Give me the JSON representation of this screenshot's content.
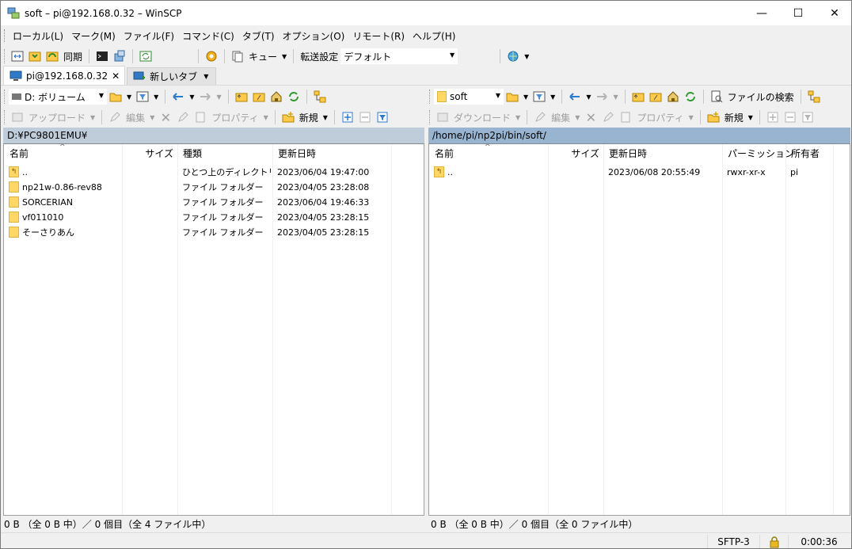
{
  "window": {
    "title": "soft – pi@192.168.0.32 – WinSCP"
  },
  "menu": [
    "ローカル(L)",
    "マーク(M)",
    "ファイル(F)",
    "コマンド(C)",
    "タブ(T)",
    "オプション(O)",
    "リモート(R)",
    "ヘルプ(H)"
  ],
  "toolbar": {
    "sync_label": "同期",
    "queue_label": "キュー",
    "transfer_settings_label": "転送設定",
    "transfer_preset": "デフォルト"
  },
  "tabs": [
    {
      "label": "pi@192.168.0.32",
      "active": true
    },
    {
      "label": "新しいタブ",
      "active": false
    }
  ],
  "local": {
    "drive": "D: ボリューム",
    "upload_label": "アップロード",
    "edit_label": "編集",
    "properties_label": "プロパティ",
    "new_label": "新規",
    "path": "D:¥PC9801EMU¥",
    "columns": [
      "名前",
      "サイズ",
      "種類",
      "更新日時"
    ],
    "files": [
      {
        "name": "..",
        "size": "",
        "type": "ひとつ上のディレクトリ",
        "modified": "2023/06/04 19:47:00",
        "up": true
      },
      {
        "name": "np21w-0.86-rev88",
        "size": "",
        "type": "ファイル フォルダー",
        "modified": "2023/04/05 23:28:08",
        "up": false
      },
      {
        "name": "SORCERIAN",
        "size": "",
        "type": "ファイル フォルダー",
        "modified": "2023/06/04 19:46:33",
        "up": false
      },
      {
        "name": "vf011010",
        "size": "",
        "type": "ファイル フォルダー",
        "modified": "2023/04/05 23:28:15",
        "up": false
      },
      {
        "name": "そーさりあん",
        "size": "",
        "type": "ファイル フォルダー",
        "modified": "2023/04/05 23:28:15",
        "up": false
      }
    ],
    "status": "0 B （全 0 B 中）／ 0 個目（全 4 ファイル中）"
  },
  "remote": {
    "folder": "soft",
    "download_label": "ダウンロード",
    "edit_label": "編集",
    "properties_label": "プロパティ",
    "new_label": "新規",
    "find_label": "ファイルの検索",
    "path": "/home/pi/np2pi/bin/soft/",
    "columns": [
      "名前",
      "サイズ",
      "更新日時",
      "パーミッション",
      "所有者"
    ],
    "files": [
      {
        "name": "..",
        "size": "",
        "modified": "2023/06/08 20:55:49",
        "permissions": "rwxr-xr-x",
        "owner": "pi"
      }
    ],
    "status": "0 B （全 0 B 中）／ 0 個目（全 0 ファイル中）"
  },
  "statusbar": {
    "protocol": "SFTP-3",
    "elapsed": "0:00:36"
  },
  "colors": {
    "active_path": "#99b4d1",
    "inactive_path": "#bfcddb",
    "folder": "#ffd766"
  }
}
